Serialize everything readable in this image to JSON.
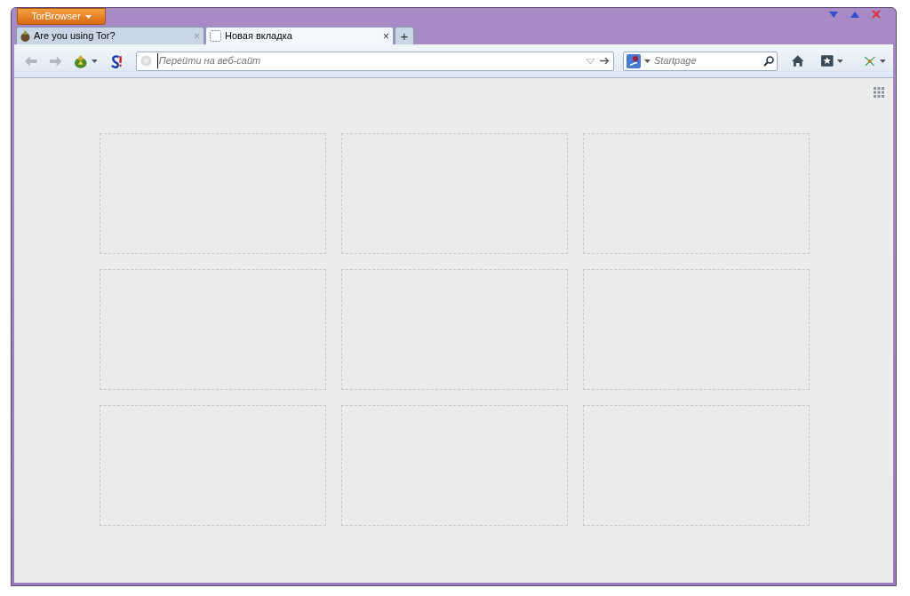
{
  "app_menu": {
    "label": "TorBrowser"
  },
  "tabs": [
    {
      "title": "Are you using Tor?",
      "close": "×",
      "selected": false
    },
    {
      "title": "Новая вкладка",
      "close": "×",
      "selected": true
    }
  ],
  "new_tab_button": {
    "label": "+"
  },
  "address_bar": {
    "placeholder": "Перейти на веб-сайт"
  },
  "search_bar": {
    "placeholder": "Startpage"
  },
  "tiles": [
    {
      "kind": "empty"
    },
    {
      "kind": "empty"
    },
    {
      "kind": "empty"
    },
    {
      "kind": "empty"
    },
    {
      "kind": "empty"
    },
    {
      "kind": "empty"
    },
    {
      "kind": "empty"
    },
    {
      "kind": "empty"
    },
    {
      "kind": "empty"
    }
  ]
}
